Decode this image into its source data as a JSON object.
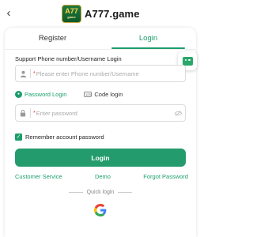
{
  "header": {
    "back_icon": "chevron-left-icon",
    "back_glyph": "‹",
    "logo_badge_text": "A77",
    "logo_badge_sub": "game",
    "app_name": "A777.game"
  },
  "tabs": [
    {
      "label": "Register",
      "active": false
    },
    {
      "label": "Login",
      "active": true
    }
  ],
  "form": {
    "support_label": "Support Phone number/Username Login",
    "phone_placeholder": "Please enter Phone number/Username",
    "password_login_label": "Password Login",
    "code_login_label": "Code login",
    "code_icon_text": "123",
    "password_placeholder": "Enter password",
    "required_mark": "*",
    "remember_label": "Remember account password",
    "remember_checked": true,
    "login_button": "Login"
  },
  "links": {
    "customer_service": "Customer Service",
    "demo": "Demo",
    "forgot_password": "Forgot Password"
  },
  "quick_login": {
    "label": "Quick login",
    "providers": [
      "google-icon"
    ]
  },
  "colors": {
    "accent": "#1a9e6b",
    "button": "#239b6d",
    "required": "#e33333"
  }
}
